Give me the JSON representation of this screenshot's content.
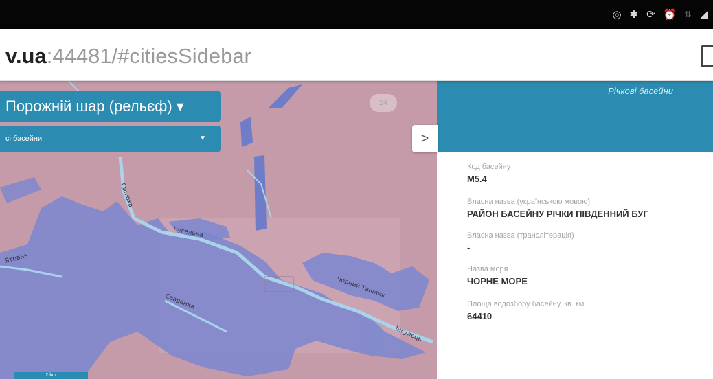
{
  "status_bar": {
    "icons": [
      "record-icon",
      "bluetooth-icon",
      "sync-icon",
      "alarm-icon",
      "wifi-icon",
      "signal-icon"
    ]
  },
  "browser": {
    "url_host": "v.ua",
    "url_rest": ":44481/#citiesSidebar"
  },
  "map": {
    "layer_button_label": "Порожній шар (рельєф) ▾",
    "basin_select_label": "сі басейни",
    "zoom_badge": "24",
    "scale_label": "2 km",
    "toggle_label": ">",
    "river_labels": [
      "Бугельна",
      "Синюха",
      "Ятрань",
      "Чорний Ташлик",
      "Савранка",
      "Інгулець"
    ]
  },
  "sidebar": {
    "title": "Річкові басейни",
    "fields": [
      {
        "label": "Код басейну",
        "value": "M5.4"
      },
      {
        "label": "Власна назва (українською мовою)",
        "value": "РАЙОН БАСЕЙНУ РІЧКИ ПІВДЕННИЙ БУГ"
      },
      {
        "label": "Власна назва (транслітерація)",
        "value": "-"
      },
      {
        "label": "Назва моря",
        "value": "ЧОРНЕ МОРЕ"
      },
      {
        "label": "Площа водозбору басейну, кв. км",
        "value": "64410"
      }
    ]
  },
  "colors": {
    "accent": "#2b8bb0",
    "map_background": "#c59aa9",
    "basin_fill": "#7a86d0",
    "river": "#a8d3ea"
  }
}
